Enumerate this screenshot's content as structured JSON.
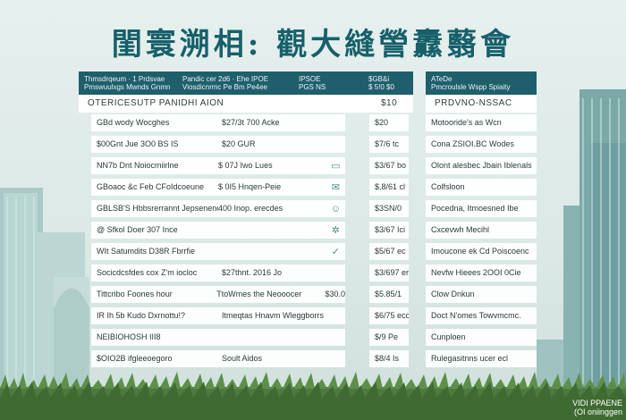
{
  "title": "閨寰溯相: 觀大縫謍纛蘙會",
  "left_panel": {
    "header": [
      "Thmsdrqeum · 1 Prdsvae",
      "Pmswuulxgs Mwnds Gnmn",
      "Pandic cer 2d6 · Ehe IPOE",
      "Viosdicnrmc Pe Bm Pe4ee",
      "IPSOE",
      "PGS NS"
    ],
    "subheader": "OTERICESUTP PANIDHI AION",
    "rows": [
      {
        "a": "GBd wody Wocghes",
        "b": "$27/3t  700 Acke",
        "c": "",
        "icon": ""
      },
      {
        "a": "$00Gnt Jue 3O0 BS IS",
        "b": "$20  GUR",
        "c": "",
        "icon": ""
      },
      {
        "a": "NN7b Dnt Noiocmiirlne",
        "b": "$ 07J  Iwo Lues",
        "c": "",
        "icon": "slider-icon"
      },
      {
        "a": "GBoaoc &c Feb CFoIdcoeune",
        "b": "$ 0I5  Hnqen-Peie",
        "c": "",
        "icon": "envelope-icon"
      },
      {
        "a": "GBLSB'S Hbbsrerrannt Jepsenenc",
        "b": "400  Inop. erecdes",
        "c": "",
        "icon": "people-icon"
      },
      {
        "a": "@ Sfkol Doer 307 Ince",
        "b": "",
        "c": "",
        "icon": "gear-icon"
      },
      {
        "a": "WIt Satumdits D38R Fbrrfie",
        "b": "",
        "c": "",
        "icon": "check-icon"
      },
      {
        "a": "Socicdcsfdes cox Z'm iocloc",
        "b": "$27thnt.  2016  Jo",
        "c": "",
        "icon": ""
      },
      {
        "a": "Tittcribo Foones hour",
        "b": "TtoWmes the Neooocer",
        "c": "$30.0",
        "icon": ""
      },
      {
        "a": "IR Ih 5b Kudo Dxrnottu!?",
        "b": "Itmeqtas Hnavm Wleggborrs",
        "c": "",
        "icon": ""
      },
      {
        "a": "NEIBIOHOSH III8",
        "b": "",
        "c": "",
        "icon": ""
      },
      {
        "a": "$OIO2B ifgleeoegoro",
        "b": "Soult Aidos",
        "c": "",
        "icon": ""
      }
    ]
  },
  "mid_panel": {
    "header": [
      "$GB&i",
      "$ 5!0 $0"
    ],
    "subheader": "$10",
    "rows": [
      "$20",
      "$7/6 tc",
      "$3/67 bo",
      "$,8/61 cl",
      "$3SN/0",
      "$3/67 Ici",
      "$5/67 ec",
      "$3/697 er",
      "$5.85/1",
      "$6/75 ecc",
      "$/9 Pe",
      "$8/4 Is"
    ]
  },
  "right_panel": {
    "header": [
      "ATeDe",
      "Pmcroulsle Wspp Spiaity"
    ],
    "subheader": "PRDVNO-NSSAC",
    "rows": [
      "Motooride's as Wcn",
      "Cona ZSIOI.BC Wodes",
      "Olont alesbec Jbain Iblenals",
      "Colfsloon",
      "Pocedna, Itmoesned Ibe",
      "Cxcevwh Mecihl",
      "Imoucone ek Cd Poiscoenc",
      "Nevfw Hieees  2OOI 0Cie",
      "Clow Dnkun",
      "Doct N'omes Towvmcmc.",
      "Cunploen",
      "Rulegasitnns ucer ecl"
    ]
  },
  "watermark": [
    "VIDI PPAENE",
    "(OI oniinggen"
  ],
  "colors": {
    "header_bg": "#1f5f6c",
    "title": "#17606b",
    "background": "#e6f0ee",
    "grass": "#4d7a3e"
  }
}
